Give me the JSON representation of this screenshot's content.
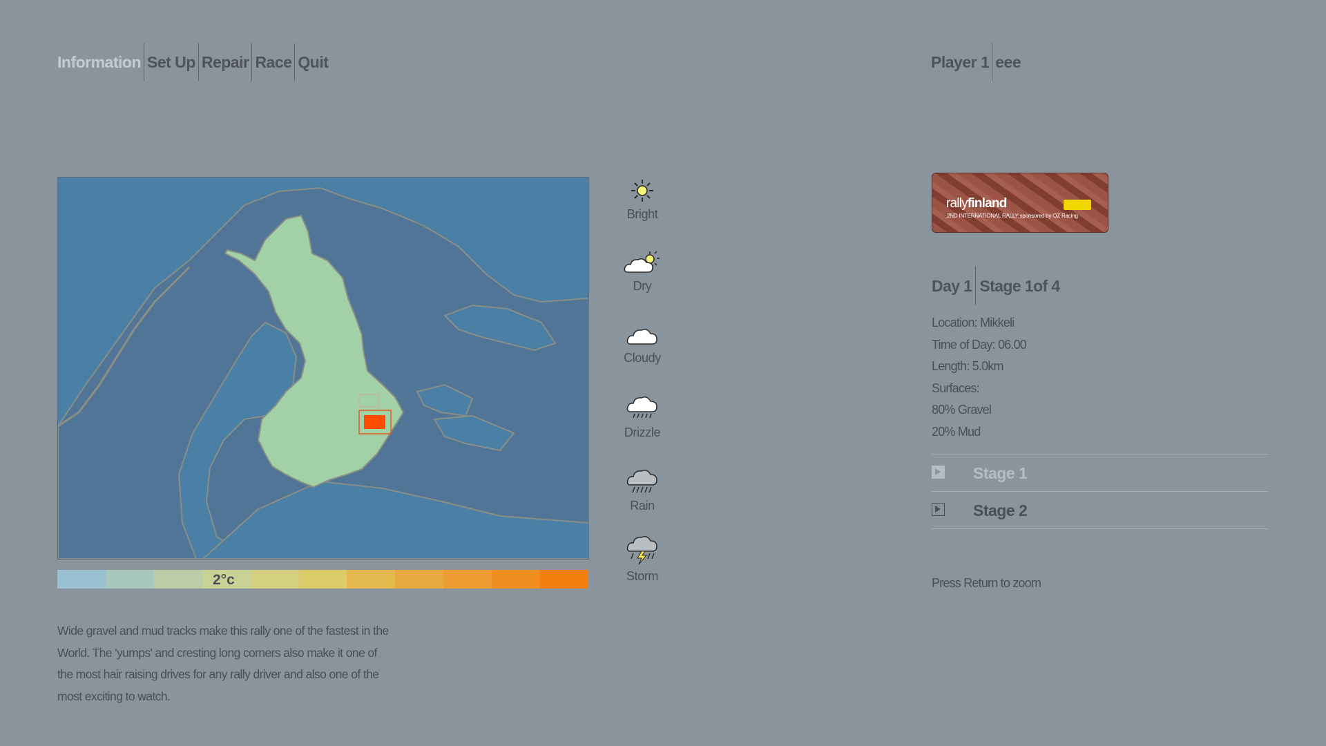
{
  "nav": {
    "tabs": [
      {
        "label": "Information",
        "active": true
      },
      {
        "label": "Set Up"
      },
      {
        "label": "Repair"
      },
      {
        "label": "Race"
      },
      {
        "label": "Quit"
      }
    ]
  },
  "player": {
    "label": "Player 1",
    "name": "eee"
  },
  "map": {
    "country": "Finland",
    "colors": {
      "sea": "#4a7fa6",
      "land": "#517597",
      "highlight": "#a2d1a8",
      "marker": "#ff4d00"
    }
  },
  "temperature": {
    "value": "2°c",
    "gradient": [
      "#9ac1d2",
      "#a8c8bb",
      "#bccda5",
      "#c9d295",
      "#d4d080",
      "#ddcb6a",
      "#e4b94e",
      "#e8aa3f",
      "#ec9c30",
      "#f08e20",
      "#f47f10"
    ]
  },
  "description": "Wide gravel and mud tracks make this rally one of the fastest in the World. The 'yumps' and cresting long corners also make it one of the most hair raising drives for any rally driver and also one of the most exciting to watch.",
  "weather": [
    {
      "label": "Bright",
      "icon": "sun-icon"
    },
    {
      "label": "Dry",
      "icon": "cloud-sun-icon"
    },
    {
      "label": "Cloudy",
      "icon": "cloud-icon"
    },
    {
      "label": "Drizzle",
      "icon": "drizzle-icon"
    },
    {
      "label": "Rain",
      "icon": "rain-icon"
    },
    {
      "label": "Storm",
      "icon": "storm-icon"
    }
  ],
  "banner": {
    "brand_light": "rally",
    "brand_bold": "finland",
    "subtitle": "2ND INTERNATIONAL RALLY sponsored by OZ Racing"
  },
  "stage_info": {
    "day": "Day 1",
    "stage": "Stage 1of 4",
    "location": "Location: Mikkeli",
    "time_of_day": "Time of Day: 06.00",
    "length": "Length: 5.0km",
    "surfaces_label": "Surfaces:",
    "surface_1": "80% Gravel",
    "surface_2": "20% Mud"
  },
  "stages": [
    {
      "label": "Stage 1",
      "selected": true
    },
    {
      "label": "Stage 2"
    }
  ],
  "hint": "Press Return to zoom"
}
